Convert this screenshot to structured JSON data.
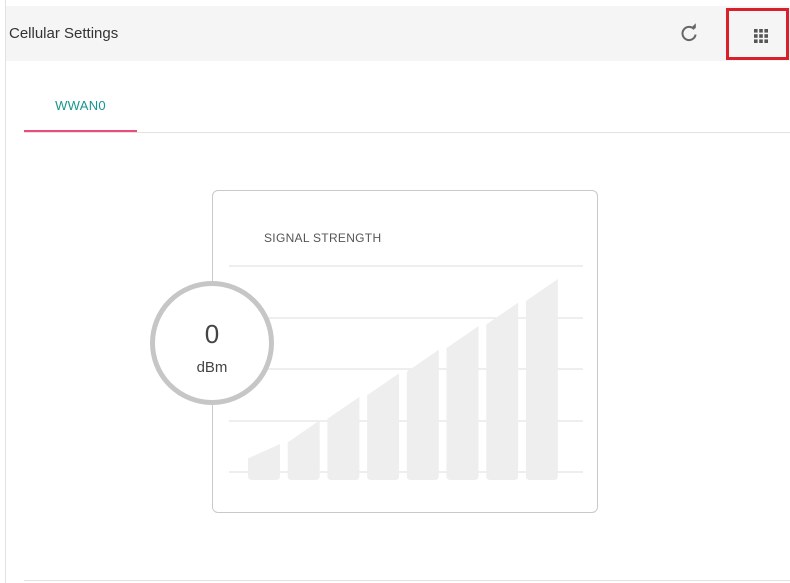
{
  "header": {
    "title": "Cellular Settings",
    "refresh_icon": "refresh-icon",
    "apps_icon": "apps-grid-icon"
  },
  "tabs": [
    {
      "label": "WWAN0",
      "active": true
    }
  ],
  "signal_card": {
    "title": "SIGNAL STRENGTH",
    "value": "0",
    "unit": "dBm",
    "bars_total": 8,
    "bars_active": 0
  },
  "colors": {
    "accent_teal": "#16968f",
    "tab_underline": "#ec4c79",
    "highlight_box": "#d9202a",
    "bar_inactive": "#eeeeee"
  }
}
